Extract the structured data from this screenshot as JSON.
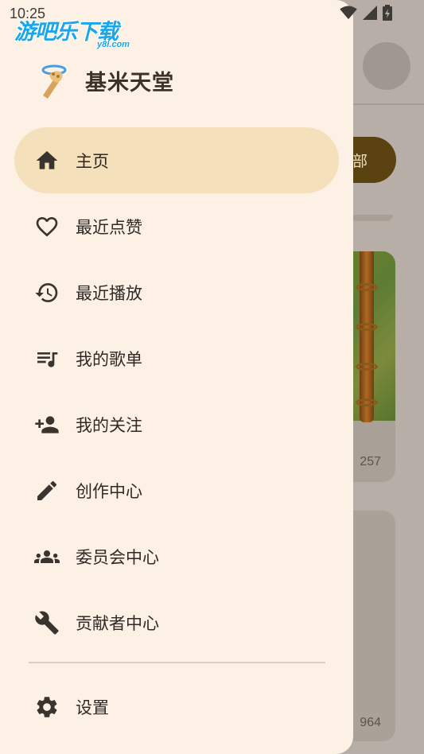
{
  "status_bar": {
    "time": "10:25"
  },
  "watermark": {
    "text": "游吧乐下载",
    "sub": "y8l.com"
  },
  "drawer": {
    "app_name": "基米天堂",
    "items": [
      {
        "label": "主页",
        "icon": "home-icon",
        "active": true
      },
      {
        "label": "最近点赞",
        "icon": "heart-outline-icon",
        "active": false
      },
      {
        "label": "最近播放",
        "icon": "history-icon",
        "active": false
      },
      {
        "label": "我的歌单",
        "icon": "playlist-icon",
        "active": false
      },
      {
        "label": "我的关注",
        "icon": "person-add-icon",
        "active": false
      },
      {
        "label": "创作中心",
        "icon": "pencil-icon",
        "active": false
      },
      {
        "label": "委员会中心",
        "icon": "group-icon",
        "active": false
      },
      {
        "label": "贡献者中心",
        "icon": "wrench-icon",
        "active": false
      }
    ],
    "settings_label": "设置"
  },
  "background": {
    "chip_label": "部",
    "card1_count": "257",
    "card2_count": "964"
  },
  "colors": {
    "drawer_bg": "#fdf1e6",
    "active_item_bg": "#f5e0bc",
    "chip_bg": "#5a4311",
    "scrim": "#b7afa7"
  }
}
